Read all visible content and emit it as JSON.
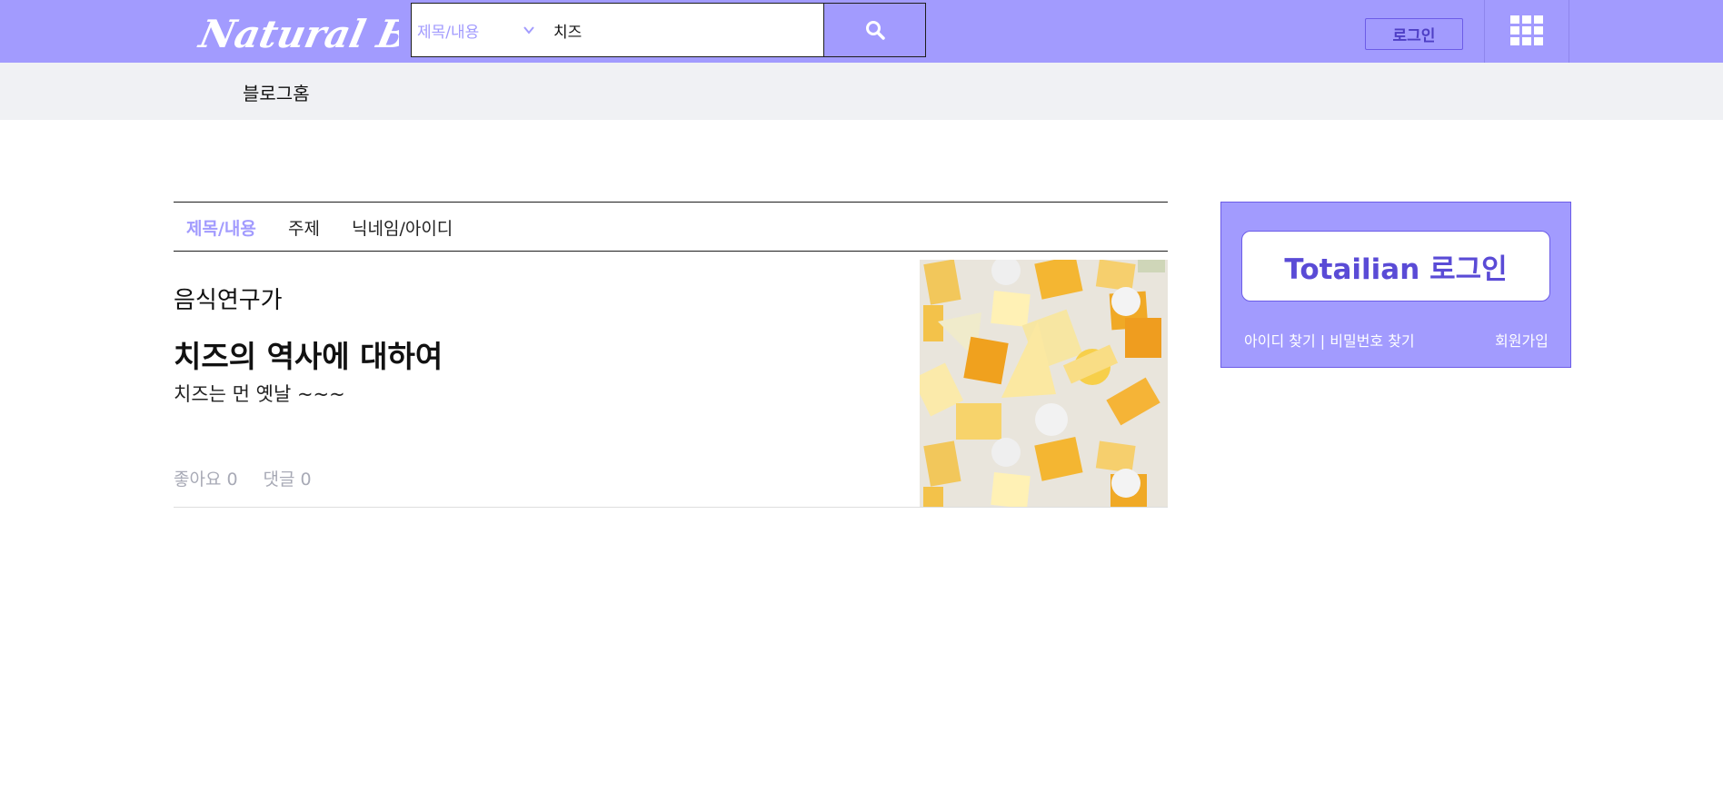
{
  "header": {
    "logo_text": "Natural Blog",
    "search_type_selected": "제목/내용",
    "search_query": "치즈",
    "login_label": "로그인",
    "accent_color": "#a29bfe",
    "search_icon": "search-icon",
    "apps_icon": "grid-icon"
  },
  "subnav": {
    "blog_home_label": "블로그홈"
  },
  "tabs": [
    {
      "label": "제목/내용",
      "active": true
    },
    {
      "label": "주제",
      "active": false
    },
    {
      "label": "닉네임/아이디",
      "active": false
    }
  ],
  "post": {
    "author": "음식연구가",
    "title": "치즈의 역사에 대하여",
    "excerpt": "치즈는 먼 옛날 ~~~",
    "likes_label": "좋아요",
    "likes_count": "0",
    "comments_label": "댓글",
    "comments_count": "0"
  },
  "side_login": {
    "button_label": "Totailian 로그인",
    "find_links": "아이디 찾기 | 비밀번호 찾기",
    "join_label": "회원가입"
  }
}
